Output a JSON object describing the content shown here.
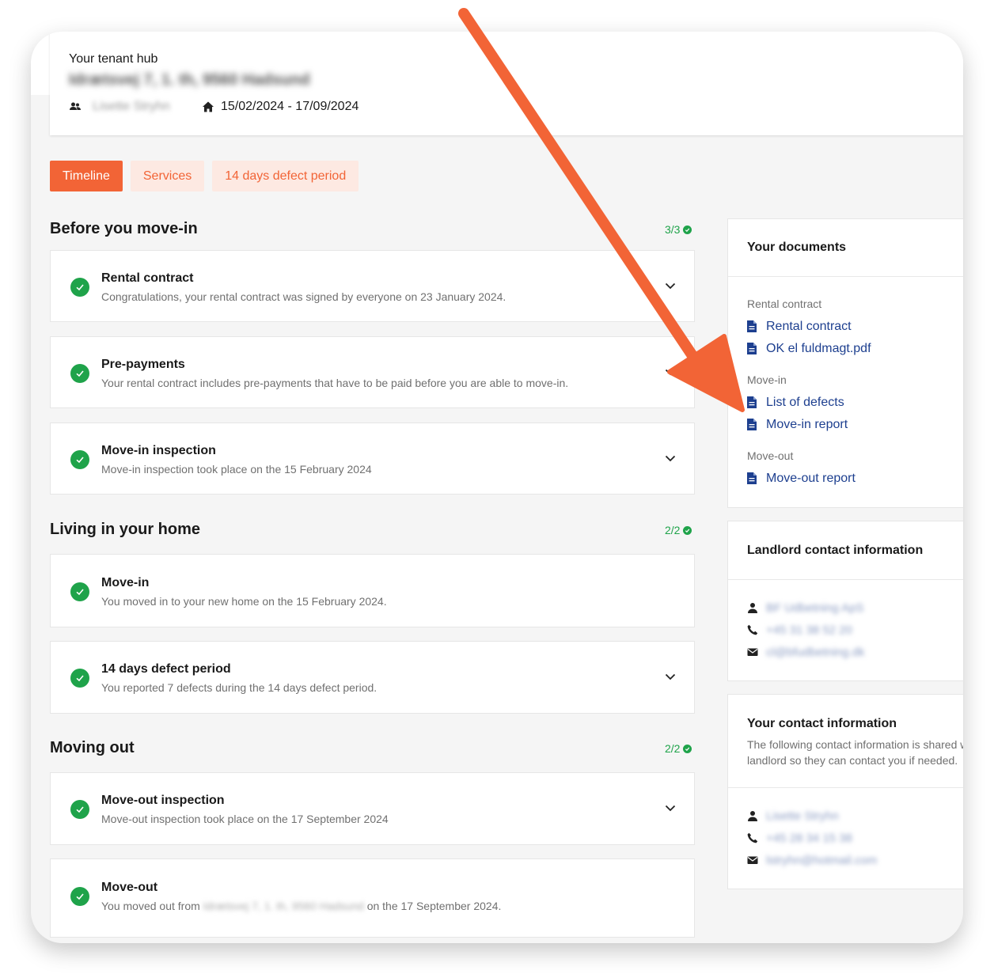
{
  "header": {
    "hub_title": "Your tenant hub",
    "address": "Idrætsvej 7, 1. th, 9560 Hadsund",
    "tenant_name": "Lisette Stryhn",
    "dates": "15/02/2024 - 17/09/2024"
  },
  "tabs": [
    {
      "label": "Timeline",
      "active": true
    },
    {
      "label": "Services",
      "active": false
    },
    {
      "label": "14 days defect period",
      "active": false
    }
  ],
  "sections": [
    {
      "title": "Before you move-in",
      "progress": "3/3",
      "steps": [
        {
          "title": "Rental contract",
          "desc": "Congratulations, your rental contract was signed by everyone on 23 January 2024."
        },
        {
          "title": "Pre-payments",
          "desc": "Your rental contract includes pre-payments that have to be paid before you are able to move-in."
        },
        {
          "title": "Move-in inspection",
          "desc": "Move-in inspection took place on the 15 February 2024"
        }
      ]
    },
    {
      "title": "Living in your home",
      "progress": "2/2",
      "steps": [
        {
          "title": "Move-in",
          "desc": "You moved in to your new home on the 15 February 2024."
        },
        {
          "title": "14 days defect period",
          "desc": "You reported 7 defects during the 14 days defect period."
        }
      ]
    },
    {
      "title": "Moving out",
      "progress": "2/2",
      "steps": [
        {
          "title": "Move-out inspection",
          "desc": "Move-out inspection took place on the 17 September 2024"
        },
        {
          "title": "Move-out",
          "desc_prefix": "You moved out from",
          "desc_address": "Idrætsvej 7, 1. th, 9560 Hadsund",
          "desc_suffix": "on the 17 September 2024."
        }
      ]
    }
  ],
  "documents": {
    "title": "Your documents",
    "groups": [
      {
        "label": "Rental contract",
        "items": [
          "Rental contract",
          "OK el fuldmagt.pdf"
        ]
      },
      {
        "label": "Move-in",
        "items": [
          "List of defects",
          "Move-in report"
        ]
      },
      {
        "label": "Move-out",
        "items": [
          "Move-out report"
        ]
      }
    ]
  },
  "landlord": {
    "title": "Landlord contact information",
    "name": "BF Udbetning ApS",
    "phone": "+45 31 38 52 20",
    "email": "cl@bfudbetning.dk"
  },
  "your_contact": {
    "title": "Your contact information",
    "desc_line1": "The following contact information is shared with your",
    "desc_line2": "landlord so they can contact you if needed.",
    "name": "Lisette Stryhn",
    "phone": "+45 28 34 15 38",
    "email": "lstryhn@hotmail.com"
  },
  "colors": {
    "accent": "#f26436",
    "accent_light": "#fde9e2",
    "success": "#1fa34a",
    "link": "#1d3f8f"
  }
}
